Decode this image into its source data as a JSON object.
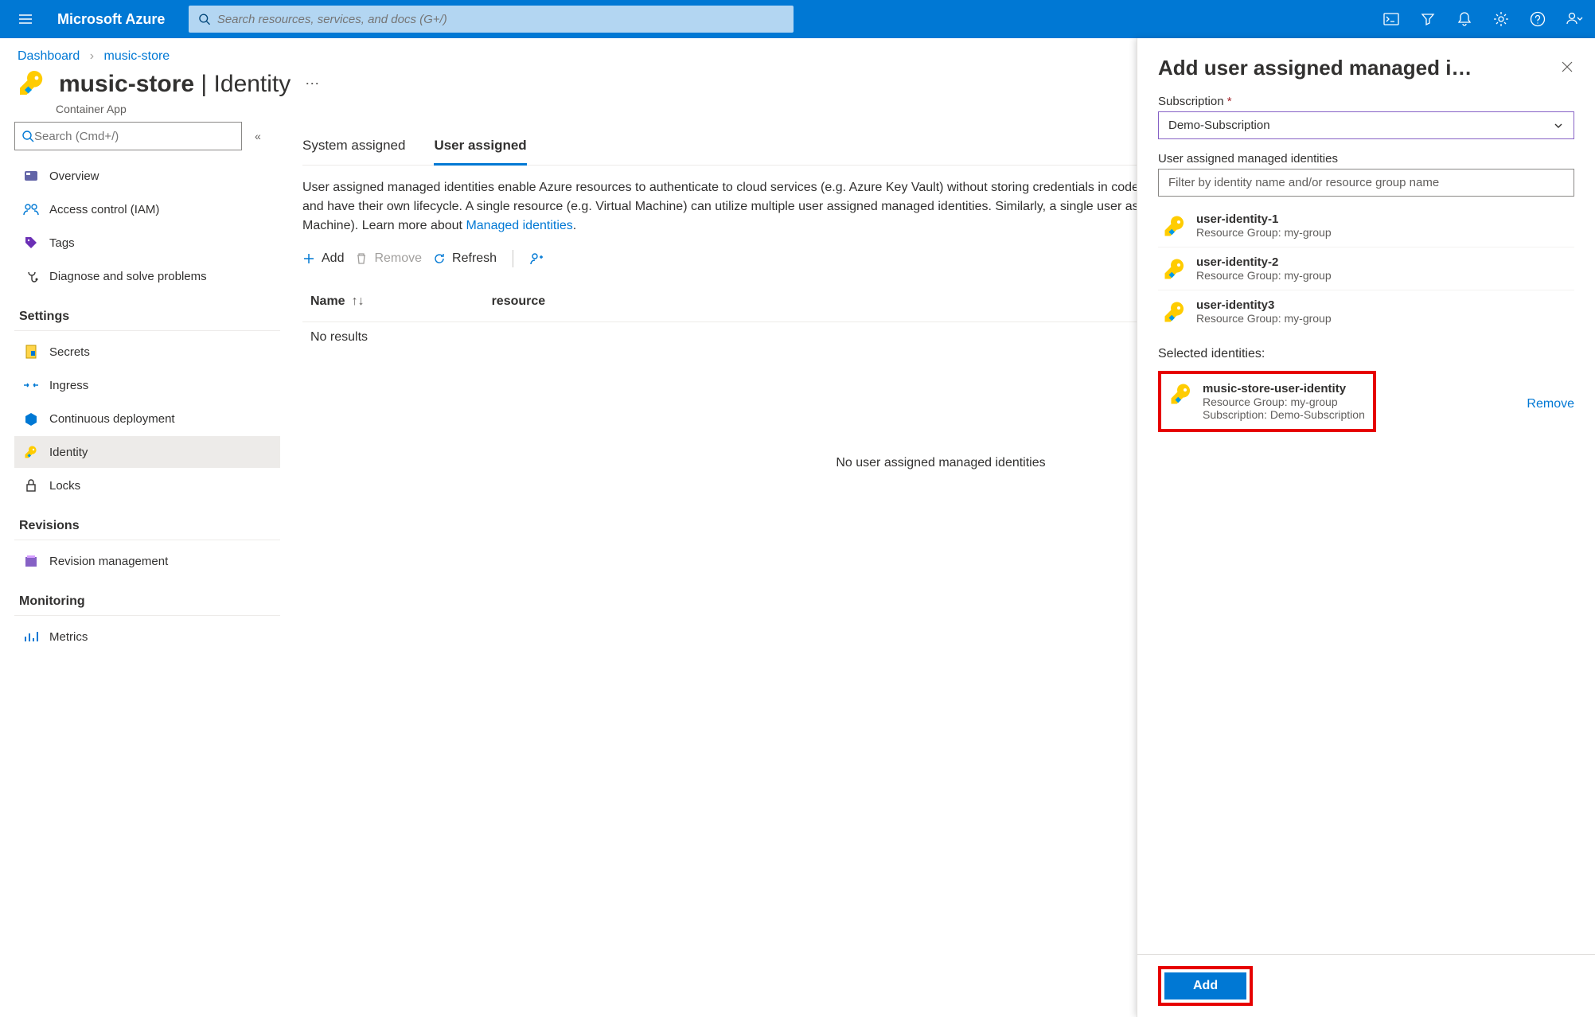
{
  "topbar": {
    "brand": "Microsoft Azure",
    "search_placeholder": "Search resources, services, and docs (G+/)"
  },
  "breadcrumbs": {
    "items": [
      "Dashboard",
      "music-store"
    ]
  },
  "header": {
    "name": "music-store",
    "section": "Identity",
    "subtitle": "Container App"
  },
  "nav": {
    "search_placeholder": "Search (Cmd+/)",
    "items": [
      {
        "label": "Overview",
        "icon": "overview"
      },
      {
        "label": "Access control (IAM)",
        "icon": "iam"
      },
      {
        "label": "Tags",
        "icon": "tags"
      },
      {
        "label": "Diagnose and solve problems",
        "icon": "diagnose"
      }
    ],
    "settings_label": "Settings",
    "settings_items": [
      {
        "label": "Secrets",
        "icon": "secrets"
      },
      {
        "label": "Ingress",
        "icon": "ingress"
      },
      {
        "label": "Continuous deployment",
        "icon": "cd"
      },
      {
        "label": "Identity",
        "icon": "identity",
        "active": true
      },
      {
        "label": "Locks",
        "icon": "locks"
      }
    ],
    "revisions_label": "Revisions",
    "revisions_items": [
      {
        "label": "Revision management",
        "icon": "revision"
      }
    ],
    "monitoring_label": "Monitoring",
    "monitoring_items": [
      {
        "label": "Metrics",
        "icon": "metrics"
      }
    ]
  },
  "main": {
    "tabs": [
      "System assigned",
      "User assigned"
    ],
    "active_tab": 1,
    "description": "User assigned managed identities enable Azure resources to authenticate to cloud services (e.g. Azure Key Vault) without storing credentials in code. This type of managed identities are created as standalone Azure resources, and have their own lifecycle. A single resource (e.g. Virtual Machine) can utilize multiple user assigned managed identities. Similarly, a single user assigned managed identity can be shared across multiple resources (e.g. Virtual Machine). Learn more about",
    "description_link": "Managed identities",
    "toolbar": {
      "add": "Add",
      "remove": "Remove",
      "refresh": "Refresh"
    },
    "table": {
      "col_name": "Name",
      "col_resource": "resource",
      "no_results": "No results"
    },
    "empty": "No user assigned managed identities"
  },
  "flyout": {
    "title": "Add user assigned managed i…",
    "subscription_label": "Subscription",
    "subscription_value": "Demo-Subscription",
    "identities_label": "User assigned managed identities",
    "filter_placeholder": "Filter by identity name and/or resource group name",
    "identities": [
      {
        "name": "user-identity-1",
        "rg": "Resource Group: my-group"
      },
      {
        "name": "user-identity-2",
        "rg": "Resource Group: my-group"
      },
      {
        "name": "user-identity3",
        "rg": "Resource Group: my-group"
      }
    ],
    "selected_label": "Selected identities:",
    "selected": {
      "name": "music-store-user-identity",
      "rg": "Resource Group: my-group",
      "sub": "Subscription: Demo-Subscription"
    },
    "remove_label": "Remove",
    "add_label": "Add"
  },
  "colors": {
    "azure_blue": "#0078d4",
    "highlight_red": "#e60000",
    "key_yellow": "#ffcc00"
  }
}
